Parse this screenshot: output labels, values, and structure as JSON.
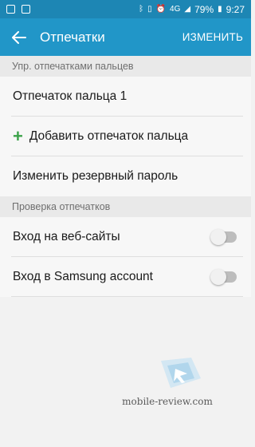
{
  "status": {
    "network": "4G",
    "battery": "79%",
    "time": "9:27"
  },
  "appbar": {
    "title": "Отпечатки",
    "action": "ИЗМЕНИТЬ"
  },
  "sections": [
    {
      "header": "Упр. отпечатками пальцев",
      "items": [
        {
          "label": "Отпечаток пальца 1"
        },
        {
          "label": "Добавить отпечаток пальца"
        },
        {
          "label": "Изменить резервный пароль"
        }
      ]
    },
    {
      "header": "Проверка отпечатков",
      "items": [
        {
          "label": "Вход на веб-сайты",
          "enabled": false
        },
        {
          "label": "Вход в Samsung account",
          "enabled": false
        }
      ]
    }
  ],
  "watermark": "mobile-review.com"
}
